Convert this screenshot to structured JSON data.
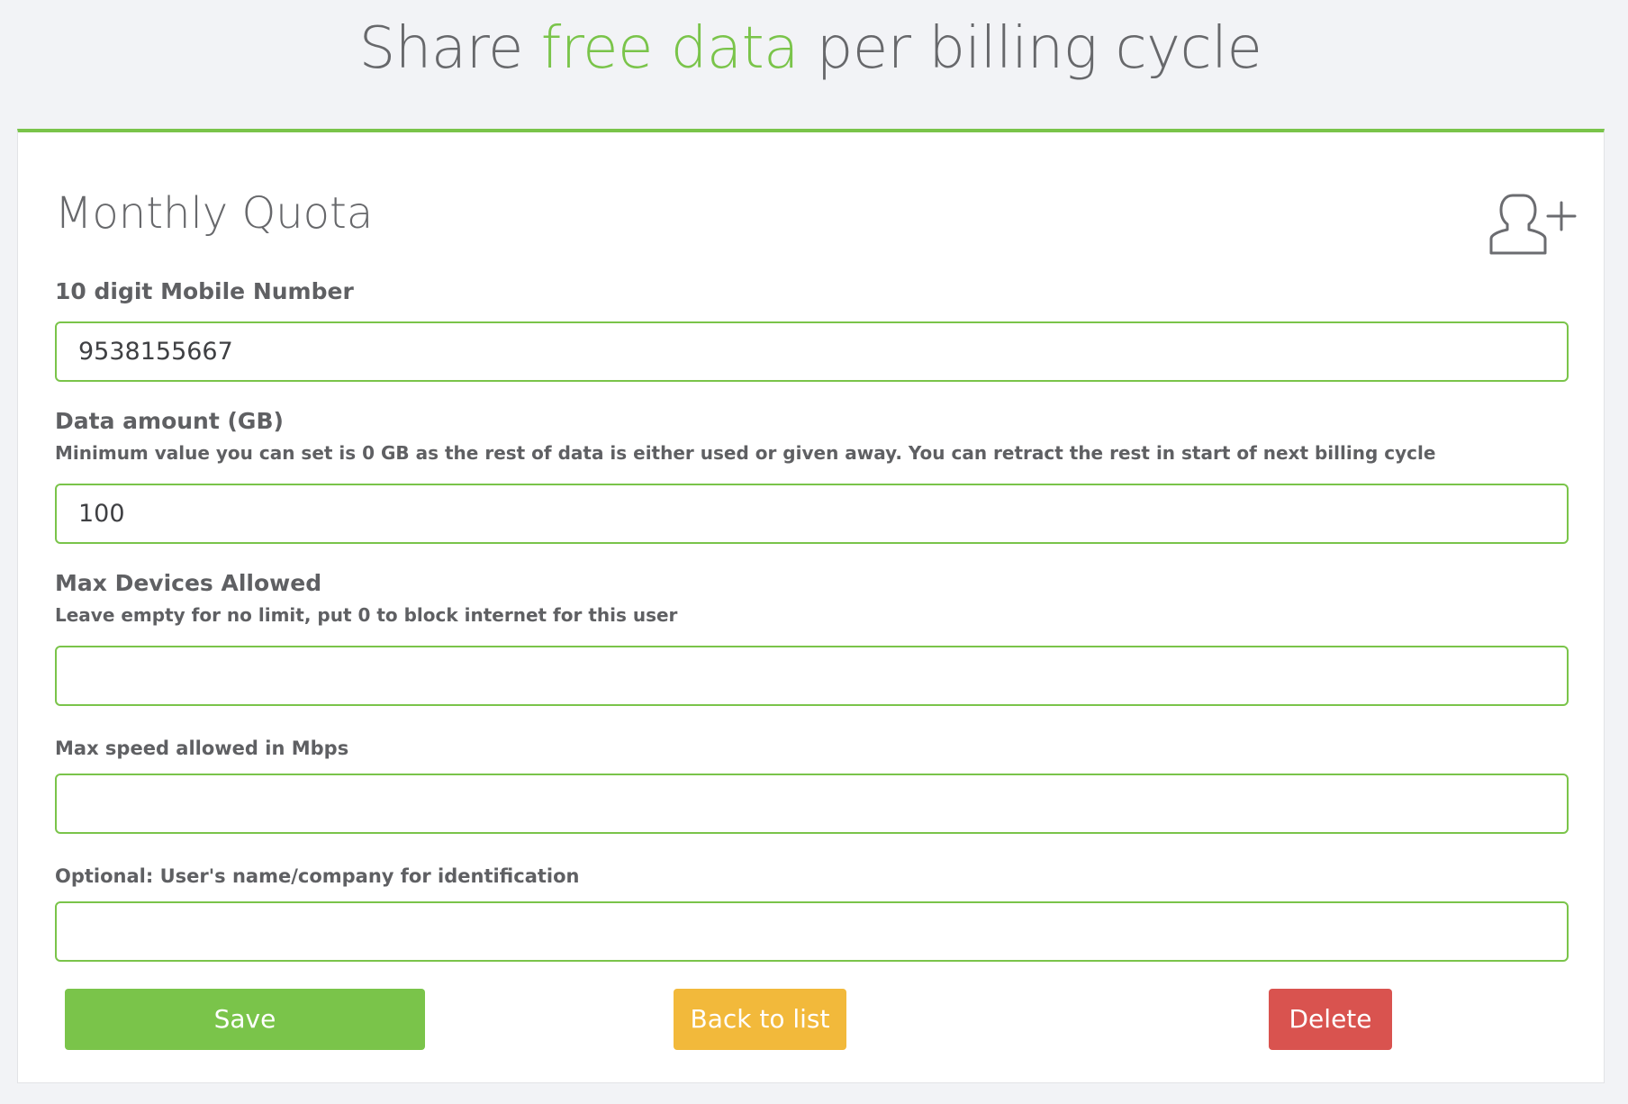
{
  "header": {
    "title_part1": "Share ",
    "title_accent": "free data",
    "title_part2": " per billing cycle",
    "accent_color": "#7ac44a"
  },
  "card": {
    "title": "Monthly Quota",
    "icon": "add-user-icon"
  },
  "fields": {
    "mobile": {
      "label": "10 digit Mobile Number",
      "value": "9538155667"
    },
    "data_amount": {
      "label": "Data amount (GB)",
      "help": "Minimum value you can set is 0 GB as the rest of data is either used or given away. You can retract the rest in start of next billing cycle",
      "value": "100"
    },
    "max_devices": {
      "label": "Max Devices Allowed",
      "help": "Leave empty for no limit, put 0 to block internet for this user",
      "value": ""
    },
    "max_speed": {
      "label": "Max speed allowed in Mbps",
      "value": ""
    },
    "user_name": {
      "label": "Optional: User's name/company for identification",
      "value": ""
    }
  },
  "buttons": {
    "save": "Save",
    "back": "Back to list",
    "delete": "Delete"
  },
  "colors": {
    "save": "#7ac44a",
    "back": "#f2b93b",
    "delete": "#d9534f"
  }
}
